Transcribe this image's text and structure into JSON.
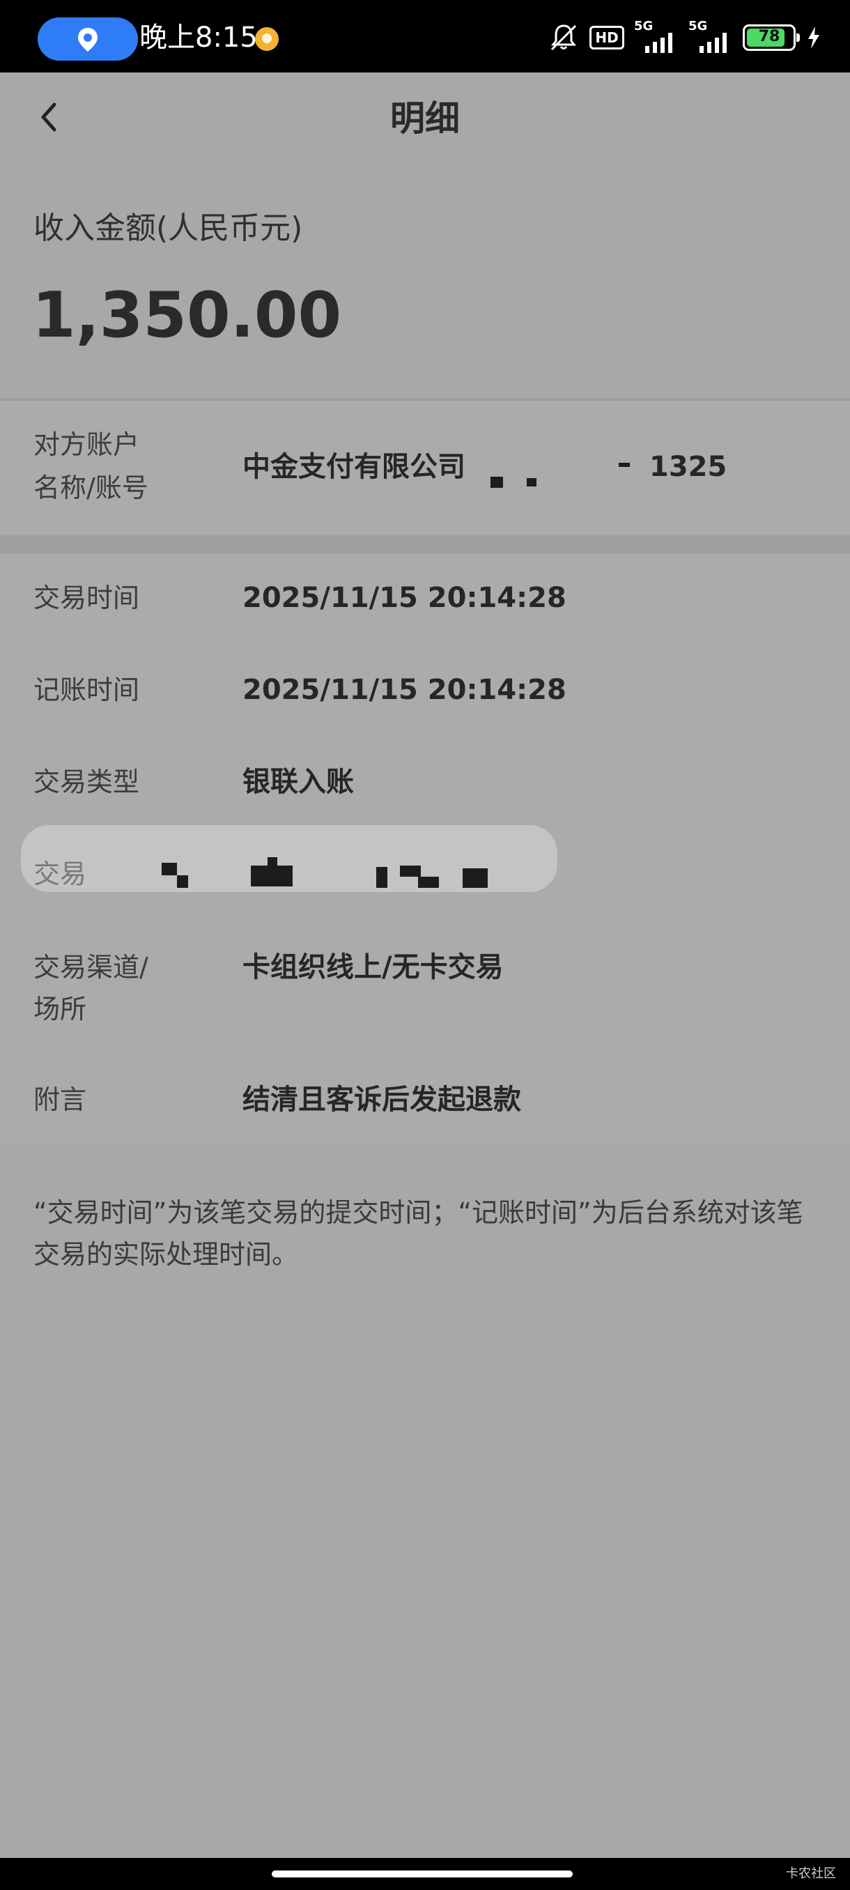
{
  "status_bar": {
    "time": "晚上8:15",
    "hd_label": "HD",
    "network_1": "5G",
    "network_2": "5G",
    "battery": "78"
  },
  "header": {
    "title": "明细"
  },
  "summary": {
    "amount_label": "收入金额(人民币元)",
    "amount": "1,350.00"
  },
  "counterparty": {
    "label_line1": "对方账户",
    "label_line2": "名称/账号",
    "name": "中金支付有限公司",
    "account_tail": "1325"
  },
  "details": [
    {
      "label": "交易时间",
      "value": "2025/11/15 20:14:28"
    },
    {
      "label": "记账时间",
      "value": "2025/11/15 20:14:28"
    },
    {
      "label": "交易类型",
      "value": "银联入账"
    },
    {
      "label": "交易",
      "value": ""
    },
    {
      "label_line1": "交易渠道/",
      "label_line2": "场所",
      "value": "卡组织线上/无卡交易"
    },
    {
      "label": "附言",
      "value": "结清且客诉后发起退款"
    }
  ],
  "note": "“交易时间”为该笔交易的提交时间；“记账时间”为后台系统对该笔交易的实际处理时间。",
  "watermark": "卡农社区",
  "colors": {
    "page_bg": "#a8a8a8",
    "location_pill": "#2f7df6",
    "battery_fill": "#4cd964"
  }
}
